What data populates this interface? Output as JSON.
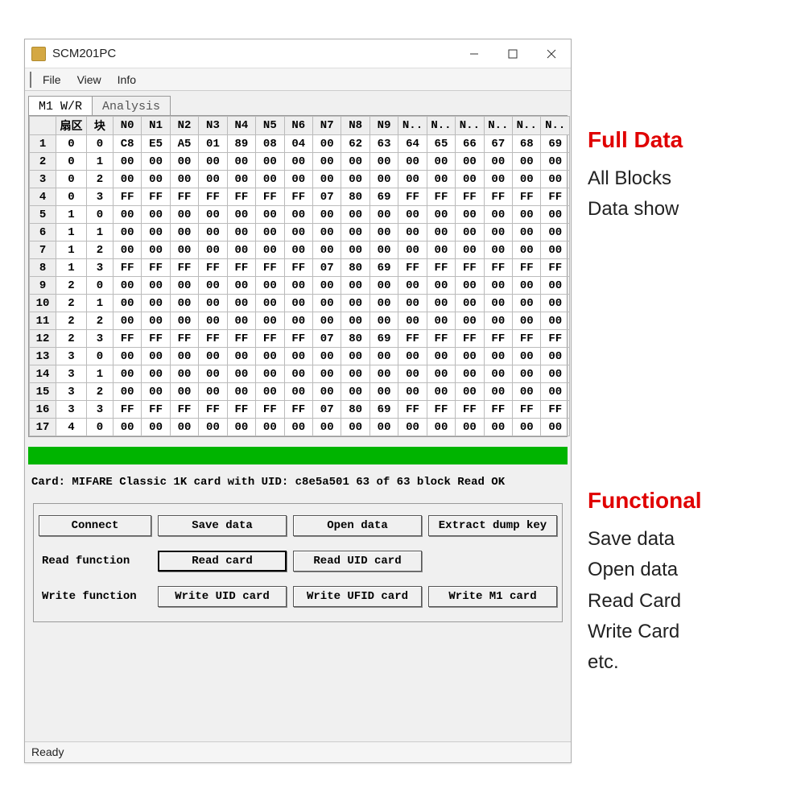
{
  "window": {
    "title": "SCM201PC",
    "menu": {
      "file": "File",
      "view": "View",
      "info": "Info"
    },
    "statusbar": "Ready"
  },
  "tabs": {
    "tab1": "M1 W/R",
    "tab2": "Analysis"
  },
  "grid": {
    "headers": [
      "",
      "扇区",
      "块",
      "N0",
      "N1",
      "N2",
      "N3",
      "N4",
      "N5",
      "N6",
      "N7",
      "N8",
      "N9",
      "N..",
      "N..",
      "N..",
      "N..",
      "N..",
      "N.."
    ],
    "rows": [
      {
        "n": "1",
        "sec": "0",
        "blk": "0",
        "d": [
          "C8",
          "E5",
          "A5",
          "01",
          "89",
          "08",
          "04",
          "00",
          "62",
          "63",
          "64",
          "65",
          "66",
          "67",
          "68",
          "69"
        ]
      },
      {
        "n": "2",
        "sec": "0",
        "blk": "1",
        "d": [
          "00",
          "00",
          "00",
          "00",
          "00",
          "00",
          "00",
          "00",
          "00",
          "00",
          "00",
          "00",
          "00",
          "00",
          "00",
          "00"
        ]
      },
      {
        "n": "3",
        "sec": "0",
        "blk": "2",
        "d": [
          "00",
          "00",
          "00",
          "00",
          "00",
          "00",
          "00",
          "00",
          "00",
          "00",
          "00",
          "00",
          "00",
          "00",
          "00",
          "00"
        ]
      },
      {
        "n": "4",
        "sec": "0",
        "blk": "3",
        "d": [
          "FF",
          "FF",
          "FF",
          "FF",
          "FF",
          "FF",
          "FF",
          "07",
          "80",
          "69",
          "FF",
          "FF",
          "FF",
          "FF",
          "FF",
          "FF"
        ]
      },
      {
        "n": "5",
        "sec": "1",
        "blk": "0",
        "d": [
          "00",
          "00",
          "00",
          "00",
          "00",
          "00",
          "00",
          "00",
          "00",
          "00",
          "00",
          "00",
          "00",
          "00",
          "00",
          "00"
        ]
      },
      {
        "n": "6",
        "sec": "1",
        "blk": "1",
        "d": [
          "00",
          "00",
          "00",
          "00",
          "00",
          "00",
          "00",
          "00",
          "00",
          "00",
          "00",
          "00",
          "00",
          "00",
          "00",
          "00"
        ]
      },
      {
        "n": "7",
        "sec": "1",
        "blk": "2",
        "d": [
          "00",
          "00",
          "00",
          "00",
          "00",
          "00",
          "00",
          "00",
          "00",
          "00",
          "00",
          "00",
          "00",
          "00",
          "00",
          "00"
        ]
      },
      {
        "n": "8",
        "sec": "1",
        "blk": "3",
        "d": [
          "FF",
          "FF",
          "FF",
          "FF",
          "FF",
          "FF",
          "FF",
          "07",
          "80",
          "69",
          "FF",
          "FF",
          "FF",
          "FF",
          "FF",
          "FF"
        ]
      },
      {
        "n": "9",
        "sec": "2",
        "blk": "0",
        "d": [
          "00",
          "00",
          "00",
          "00",
          "00",
          "00",
          "00",
          "00",
          "00",
          "00",
          "00",
          "00",
          "00",
          "00",
          "00",
          "00"
        ]
      },
      {
        "n": "10",
        "sec": "2",
        "blk": "1",
        "d": [
          "00",
          "00",
          "00",
          "00",
          "00",
          "00",
          "00",
          "00",
          "00",
          "00",
          "00",
          "00",
          "00",
          "00",
          "00",
          "00"
        ]
      },
      {
        "n": "11",
        "sec": "2",
        "blk": "2",
        "d": [
          "00",
          "00",
          "00",
          "00",
          "00",
          "00",
          "00",
          "00",
          "00",
          "00",
          "00",
          "00",
          "00",
          "00",
          "00",
          "00"
        ]
      },
      {
        "n": "12",
        "sec": "2",
        "blk": "3",
        "d": [
          "FF",
          "FF",
          "FF",
          "FF",
          "FF",
          "FF",
          "FF",
          "07",
          "80",
          "69",
          "FF",
          "FF",
          "FF",
          "FF",
          "FF",
          "FF"
        ]
      },
      {
        "n": "13",
        "sec": "3",
        "blk": "0",
        "d": [
          "00",
          "00",
          "00",
          "00",
          "00",
          "00",
          "00",
          "00",
          "00",
          "00",
          "00",
          "00",
          "00",
          "00",
          "00",
          "00"
        ]
      },
      {
        "n": "14",
        "sec": "3",
        "blk": "1",
        "d": [
          "00",
          "00",
          "00",
          "00",
          "00",
          "00",
          "00",
          "00",
          "00",
          "00",
          "00",
          "00",
          "00",
          "00",
          "00",
          "00"
        ]
      },
      {
        "n": "15",
        "sec": "3",
        "blk": "2",
        "d": [
          "00",
          "00",
          "00",
          "00",
          "00",
          "00",
          "00",
          "00",
          "00",
          "00",
          "00",
          "00",
          "00",
          "00",
          "00",
          "00"
        ]
      },
      {
        "n": "16",
        "sec": "3",
        "blk": "3",
        "d": [
          "FF",
          "FF",
          "FF",
          "FF",
          "FF",
          "FF",
          "FF",
          "07",
          "80",
          "69",
          "FF",
          "FF",
          "FF",
          "FF",
          "FF",
          "FF"
        ]
      },
      {
        "n": "17",
        "sec": "4",
        "blk": "0",
        "d": [
          "00",
          "00",
          "00",
          "00",
          "00",
          "00",
          "00",
          "00",
          "00",
          "00",
          "00",
          "00",
          "00",
          "00",
          "00",
          "00"
        ]
      }
    ]
  },
  "status_line": "Card: MIFARE Classic 1K card with UID: c8e5a501 63 of 63 block Read OK",
  "buttons": {
    "connect": "Connect",
    "save_data": "Save data",
    "open_data": "Open data",
    "extract": "Extract dump key",
    "read_label": "Read function",
    "read_card": "Read card",
    "read_uid": "Read UID card",
    "write_label": "Write function",
    "write_uid": "Write UID card",
    "write_ufid": "Write UFID card",
    "write_m1": "Write M1 card"
  },
  "anno": {
    "h1": "Full Data",
    "s1a": "All Blocks",
    "s1b": "Data show",
    "h2": "Functional",
    "s2a": "Save data",
    "s2b": "Open data",
    "s2c": "Read Card",
    "s2d": "Write Card",
    "s2e": "etc."
  }
}
